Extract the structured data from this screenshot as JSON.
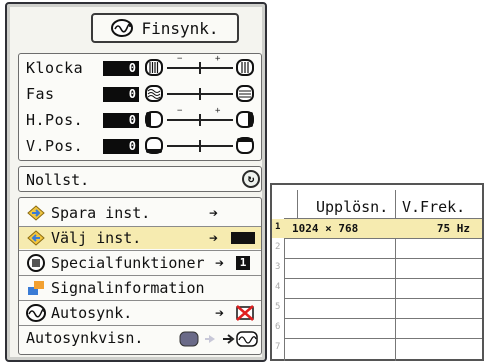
{
  "title": "Finsynk.",
  "adjust": [
    {
      "label": "Klocka",
      "value": "0"
    },
    {
      "label": "Fas",
      "value": "0"
    },
    {
      "label": "H.Pos.",
      "value": "0"
    },
    {
      "label": "V.Pos.",
      "value": "0"
    }
  ],
  "reset": {
    "label": "Nollst."
  },
  "items": [
    {
      "label": "Spara inst."
    },
    {
      "label": "Välj inst."
    },
    {
      "label": "Specialfunktioner",
      "badge": "1"
    },
    {
      "label": "Signalinformation"
    },
    {
      "label": "Autosynk."
    },
    {
      "label": "Autosynkvisn."
    }
  ],
  "table": {
    "headers": {
      "res": "Upplösn.",
      "freq": "V.Frek."
    },
    "rows": [
      {
        "num": "1",
        "res": "1024 × 768",
        "freq": "75  Hz"
      },
      {
        "num": "2",
        "res": "",
        "freq": ""
      },
      {
        "num": "3",
        "res": "",
        "freq": ""
      },
      {
        "num": "4",
        "res": "",
        "freq": ""
      },
      {
        "num": "5",
        "res": "",
        "freq": ""
      },
      {
        "num": "6",
        "res": "",
        "freq": ""
      },
      {
        "num": "7",
        "res": "",
        "freq": ""
      }
    ]
  },
  "colors": {
    "highlight": "#f6ebb0",
    "panel": "#f4f4ef",
    "border": "#2f3036"
  }
}
